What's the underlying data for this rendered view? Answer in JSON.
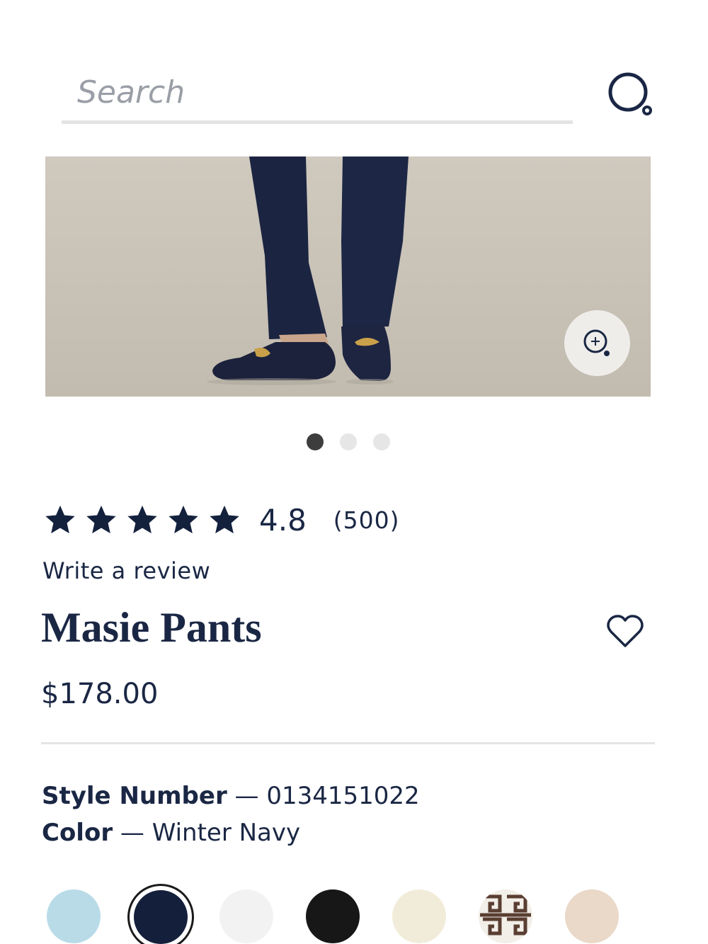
{
  "search": {
    "placeholder": "Search"
  },
  "gallery": {
    "zoom_icon": "zoom-in-icon",
    "dots_count": 3,
    "active_index": 0
  },
  "product": {
    "rating": {
      "stars": 5,
      "value": "4.8",
      "count": "(500)"
    },
    "write_review": "Write a review",
    "title": "Masie Pants",
    "price": "$178.00",
    "style_label": "Style Number",
    "style_number": "0134151022",
    "color_label": "Color",
    "color_name": "Winter Navy",
    "separator": "—"
  },
  "swatches": [
    {
      "name": "light-blue",
      "color": "#b9dbe8"
    },
    {
      "name": "winter-navy",
      "color": "#141f3b",
      "selected": true
    },
    {
      "name": "white",
      "color": "#f2f2f2"
    },
    {
      "name": "black",
      "color": "#171717"
    },
    {
      "name": "ivory",
      "color": "#f1ecd9"
    },
    {
      "name": "brown-geometric",
      "color": "#5a3e32"
    },
    {
      "name": "blush",
      "color": "#ead8c8"
    }
  ],
  "colors": {
    "navy": "#1a2744",
    "star": "#14213d",
    "divider": "#e4e4e4"
  }
}
